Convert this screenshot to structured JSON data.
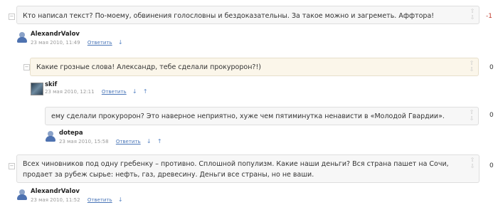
{
  "comments": [
    {
      "text": "Кто написал текст? По-моему, обвинения голословны и бездоказательны. За такое можно и загреметь. Аффтора!",
      "author": "AlexandrValov",
      "date": "23 мая 2010, 11:49",
      "reply": "Ответить",
      "score": "-1",
      "down_arrow": "↓",
      "up_arrow": ""
    },
    {
      "text": "Какие грозные слова! Александр, тебе сделали прокуророн?!)",
      "author": "skif",
      "date": "23 мая 2010, 12:11",
      "reply": "Ответить",
      "score": "0",
      "down_arrow": "↓",
      "up_arrow": "↑"
    },
    {
      "text": "ему сделали прокуророн? Это наверное неприятно, хуже чем пятиминутка ненависти в «Молодой Гвардии».",
      "author": "dotepa",
      "date": "23 мая 2010, 15:58",
      "reply": "Ответить",
      "score": "0",
      "down_arrow": "↓",
      "up_arrow": "↑"
    },
    {
      "text": "Всех чиновников под одну гребенку – противно. Сплошной популизм. Какие наши деньги? Вся страна пашет на Сочи, продает за рубеж сырье: нефть, газ, древесину. Деньги все страны, но не ваши.",
      "author": "AlexandrValov",
      "date": "23 мая 2010, 11:52",
      "reply": "Ответить",
      "score": "0",
      "down_arrow": "↓",
      "up_arrow": ""
    }
  ],
  "icons": {
    "vote_up": "⇧",
    "vote_down": "⇩",
    "collapse": "−"
  }
}
